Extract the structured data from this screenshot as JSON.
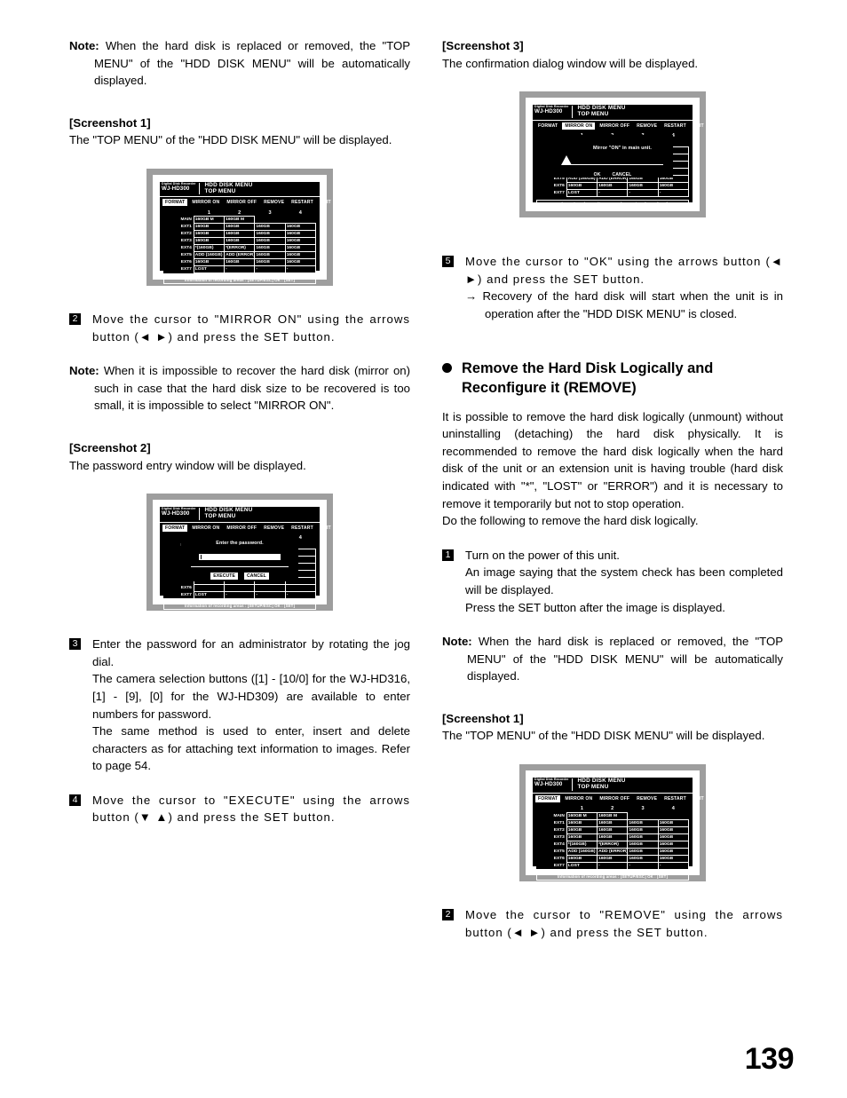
{
  "page": {
    "number": "139"
  },
  "left_column": {
    "note1": {
      "label": "Note:",
      "text": "When the hard disk is replaced or removed, the \"TOP MENU\" of the \"HDD DISK MENU\" will be automatically displayed."
    },
    "screenshot1_head": "[Screenshot 1]",
    "screenshot1_caption": "The \"TOP MENU\" of the \"HDD DISK MENU\" will be displayed.",
    "step2": {
      "num": "2",
      "text": "Move the cursor to \"MIRROR ON\" using the arrows button (◄ ►) and press the SET button."
    },
    "note2": {
      "label": "Note:",
      "text": "When it is impossible to recover the hard disk (mirror on) such in case that the hard disk size to be recovered is too small, it is impossible to select \"MIRROR ON\"."
    },
    "screenshot2_head": "[Screenshot 2]",
    "screenshot2_caption": "The password entry window will be displayed.",
    "step3": {
      "num": "3",
      "line1": "Enter the password for an administrator by rotating the jog dial.",
      "line2": "The camera selection buttons ([1] - [10/0] for the WJ-HD316, [1] - [9], [0] for the WJ-HD309) are available to enter numbers for password.",
      "line3": "The same method is used to enter, insert and delete characters as for attaching text information to images. Refer to page 54."
    },
    "step4": {
      "num": "4",
      "text": "Move the cursor to \"EXECUTE\" using the arrows button (▼ ▲) and press the SET button."
    }
  },
  "right_column": {
    "screenshot3_head": "[Screenshot 3]",
    "screenshot3_caption": "The confirmation dialog window will be displayed.",
    "step5": {
      "num": "5",
      "text": "Move the cursor to \"OK\" using the arrows button (◄ ►) and press the SET button.",
      "arrow": "→",
      "substep": "Recovery of the hard disk will start when the unit is in operation after the \"HDD DISK MENU\" is closed."
    },
    "section_heading": "Remove the Hard Disk Logically and Reconfigure it (REMOVE)",
    "body": "It is possible to remove the hard disk logically (unmount) without uninstalling (detaching) the hard disk physically. It is recommended to remove the hard disk logically when the hard disk of the unit or an extension unit is having trouble (hard disk indicated with \"*\", \"LOST\" or \"ERROR\") and it is necessary to remove it temporarily but not to stop operation.",
    "body2": "Do the following to remove the hard disk logically.",
    "step1": {
      "num": "1",
      "line1": "Turn on the power of this unit.",
      "line2": "An image saying that the system check has been completed will be displayed.",
      "line3": "Press the SET button after the image is displayed."
    },
    "note1": {
      "label": "Note:",
      "text": "When the hard disk is replaced or removed, the \"TOP MENU\" of the \"HDD DISK MENU\" will be automatically displayed."
    },
    "screenshot1_head": "[Screenshot 1]",
    "screenshot1_caption": "The \"TOP MENU\" of the \"HDD DISK MENU\" will be displayed.",
    "step2": {
      "num": "2",
      "text": "Move the cursor to \"REMOVE\" using the arrows button (◄ ►) and press the SET button."
    }
  },
  "osd": {
    "brand_line1": "Digital Disk Recorder",
    "brand_line2": "WJ-HD300",
    "title_line1": "HDD DISK MENU",
    "title_line2": "TOP MENU",
    "menu_items": [
      "FORMAT",
      "MIRROR ON",
      "MIRROR OFF",
      "REMOVE",
      "RESTART",
      "EXIT"
    ],
    "column_headers": [
      "1",
      "2",
      "3",
      "4"
    ],
    "row_labels": [
      "MAIN",
      "EXT1",
      "EXT2",
      "EXT3",
      "EXT4",
      "EXT5",
      "EXT6",
      "EXT7"
    ],
    "rows": [
      [
        "160GB M",
        "160GB M",
        "",
        ""
      ],
      [
        "160GB",
        "160GB",
        "160GB",
        "160GB"
      ],
      [
        "160GB",
        "160GB",
        "160GB",
        "160GB"
      ],
      [
        "160GB",
        "160GB",
        "160GB",
        "160GB"
      ],
      [
        "*(160GB)",
        "*(ERROR)",
        "160GB",
        "160GB"
      ],
      [
        "ADD (160GB)",
        "ADD (ERROR)",
        "160GB",
        "160GB"
      ],
      [
        "160GB",
        "160GB",
        "160GB",
        "160GB"
      ],
      [
        "LOST",
        "-",
        "-",
        "-"
      ]
    ],
    "status_bar": "Information of recording areas : [SETUP/ESC] OK : [SET]",
    "selected_menu_format": "FORMAT",
    "selected_menu_mirror_on": "MIRROR ON",
    "password_dialog": {
      "prompt": "Enter the password.",
      "value": "",
      "buttons": [
        "EXECUTE",
        "CANCEL"
      ],
      "selected_button": "EXECUTE"
    },
    "confirm_dialog": {
      "icon": "warning-icon",
      "message": "Mirror \"ON\" in main unit.",
      "buttons": [
        "OK",
        "CANCEL"
      ]
    }
  },
  "colors": {
    "osd_background": "#000000",
    "osd_foreground": "#ffffff",
    "figure_border": "#9e9e9e",
    "page_background": "#ffffff"
  }
}
